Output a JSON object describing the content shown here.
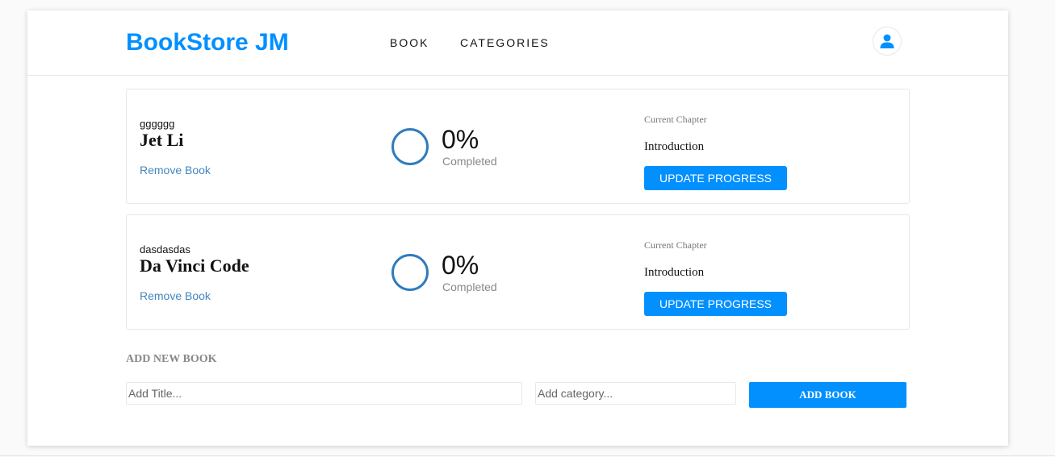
{
  "header": {
    "logo": "BookStore JM",
    "nav": [
      {
        "label": "BOOK"
      },
      {
        "label": "CATEGORIES"
      }
    ],
    "user_icon": "user-icon"
  },
  "books": [
    {
      "genre": "gggggg",
      "title": "Jet Li",
      "remove_label": "Remove Book",
      "progress_percent": 0,
      "percent_text": "0%",
      "completed_label": "Completed",
      "current_chapter_label": "Current Chapter",
      "current_chapter": "Introduction",
      "update_label": "UPDATE PROGRESS"
    },
    {
      "genre": "dasdasdas",
      "title": "Da Vinci Code",
      "remove_label": "Remove Book",
      "progress_percent": 0,
      "percent_text": "0%",
      "completed_label": "Completed",
      "current_chapter_label": "Current Chapter",
      "current_chapter": "Introduction",
      "update_label": "UPDATE PROGRESS"
    }
  ],
  "add_book": {
    "heading": "ADD NEW BOOK",
    "title_placeholder": "Add Title...",
    "title_value": "",
    "category_placeholder": "Add category...",
    "category_value": "",
    "submit_label": "ADD BOOK"
  },
  "colors": {
    "accent": "#0290ff",
    "link": "#4386bf",
    "progress_ring": "#307bbe"
  }
}
